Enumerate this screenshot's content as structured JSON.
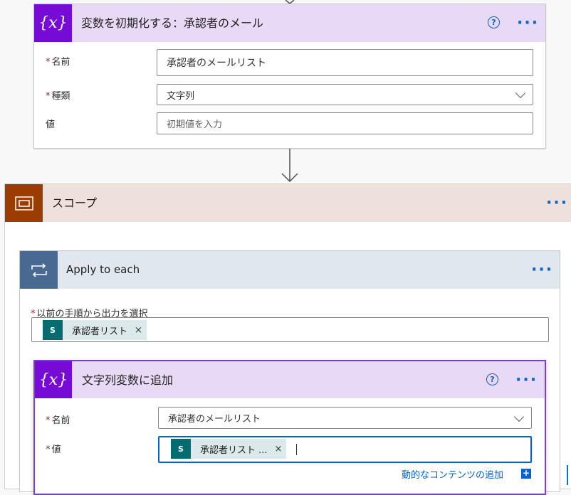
{
  "init_variable": {
    "title": "変数を初期化する：承認者のメール",
    "icon": "variable-icon",
    "fields": {
      "name_label": "名前",
      "name_value": "承認者のメールリスト",
      "type_label": "種類",
      "type_value": "文字列",
      "value_label": "値",
      "value_placeholder": "初期値を入力"
    },
    "required_mark": "*"
  },
  "scope": {
    "title": "スコープ",
    "icon": "scope-icon"
  },
  "apply_to_each": {
    "title": "Apply to each",
    "icon": "loop-icon",
    "select_label": "以前の手順から出力を選択",
    "token": {
      "text": "承認者リスト",
      "remove": "×",
      "icon": "sharepoint-icon",
      "icon_text": "S"
    }
  },
  "append_variable": {
    "title": "文字列変数に追加",
    "icon": "variable-icon",
    "name_label": "名前",
    "name_value": "承認者のメールリスト",
    "value_label": "値",
    "token": {
      "text": "承認者リスト ...",
      "remove": "×",
      "icon": "sharepoint-icon",
      "icon_text": "S"
    },
    "dynamic_content_link": "動的なコンテンツの追加",
    "dynamic_content_plus": "+"
  },
  "common": {
    "help": "?",
    "more": "···",
    "var_glyph": "{x}"
  },
  "colors": {
    "variable_purple": "#770bd6",
    "variable_header": "#e8d9f6",
    "scope_brown": "#9c3d00",
    "scope_header": "#eee0da",
    "loop_blue": "#486991",
    "loop_header": "#e1e7ee",
    "accent_blue": "#0062d6",
    "required_red": "#a4262c",
    "sharepoint_teal": "#036c70"
  }
}
